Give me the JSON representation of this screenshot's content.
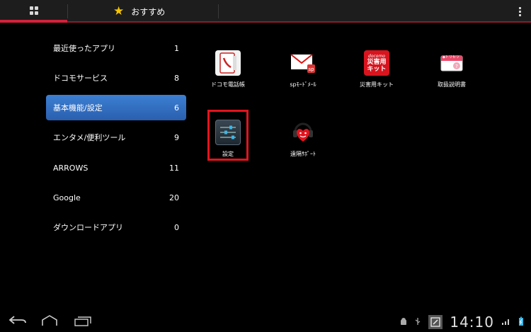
{
  "topbar": {
    "fav_label": "おすすめ"
  },
  "categories": [
    {
      "label": "最近使ったアプリ",
      "count": "1"
    },
    {
      "label": "ドコモサービス",
      "count": "8"
    },
    {
      "label": "基本機能/設定",
      "count": "6"
    },
    {
      "label": "エンタメ/便利ツール",
      "count": "9"
    },
    {
      "label": "ARROWS",
      "count": "11"
    },
    {
      "label": "Google",
      "count": "20"
    },
    {
      "label": "ダウンロードアプリ",
      "count": "0"
    }
  ],
  "apps": [
    {
      "label": "ドコモ電話帳"
    },
    {
      "label": "spﾓｰﾄﾞﾒｰﾙ"
    },
    {
      "label": "災害用キット",
      "icon_text": [
        "docomo",
        "災害用",
        "キット"
      ]
    },
    {
      "label": "取扱説明書",
      "icon_text": [
        "◆トリセツ"
      ]
    },
    {
      "label": "設定"
    },
    {
      "label": "遠隔ｻﾎﾟｰﾄ"
    }
  ],
  "status": {
    "time": "14:10"
  },
  "colors": {
    "selected": "#2f6cc0",
    "accent_red": "#d4213a",
    "star": "#f6c400",
    "highlight": "#e3141e"
  }
}
